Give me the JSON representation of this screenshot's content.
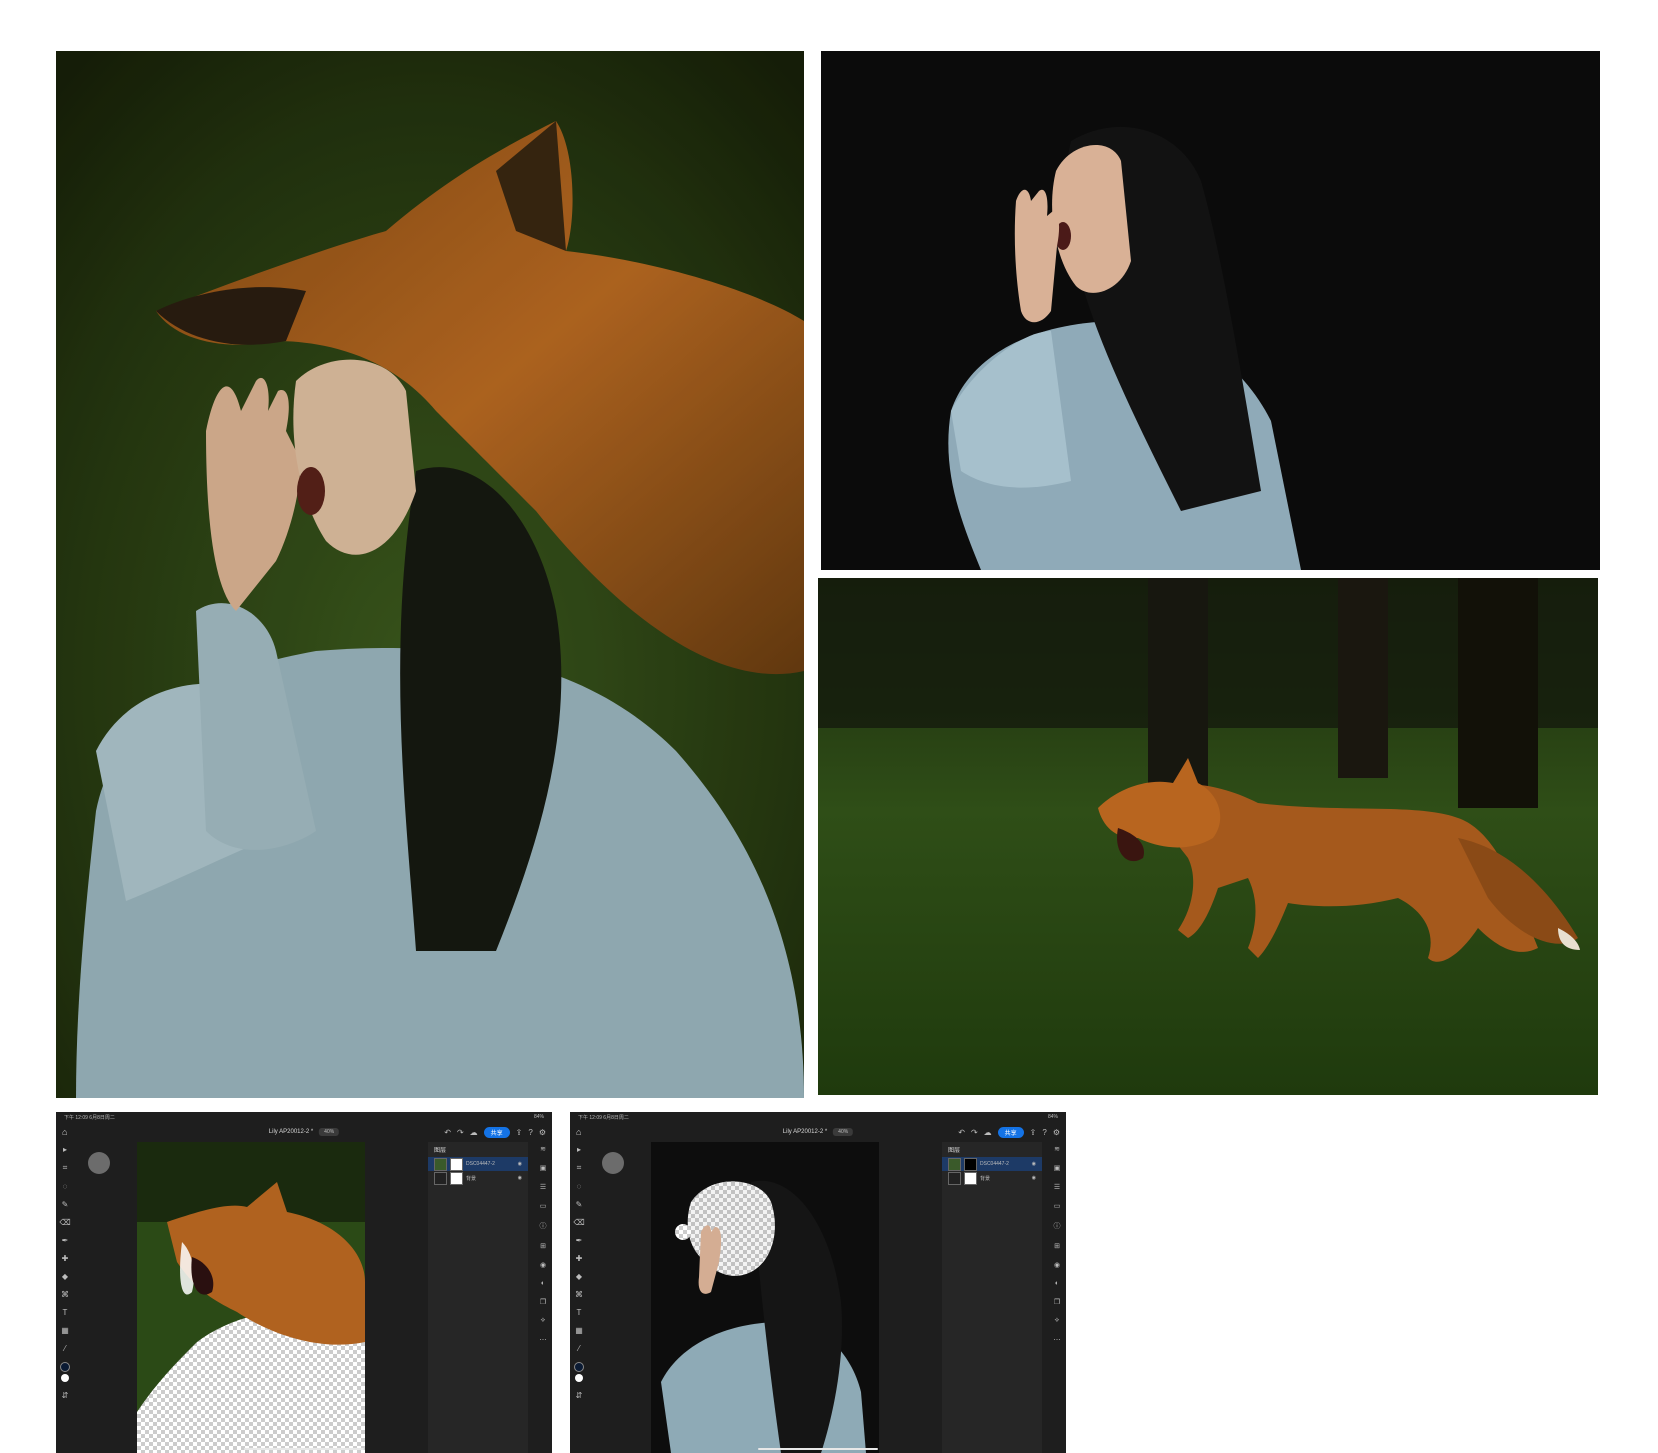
{
  "images": {
    "main_composite": "composite: girl with fox head screaming in forest",
    "woman_photo": "woman yawning with hand near mouth, dark background",
    "fox_photo": "red fox with open mouth walking on grass"
  },
  "app_left": {
    "status_time": "下午 12:09",
    "status_date": "6月8日周二",
    "battery": "84%",
    "doc_title": "Lily AP20012-2 *",
    "zoom": "40%",
    "share_label": "共享",
    "layers_title": "图层",
    "layers": [
      {
        "name": "DSC04447-2",
        "selected": true
      },
      {
        "name": "背景",
        "selected": false
      }
    ]
  },
  "app_right": {
    "status_time": "下午 12:09",
    "status_date": "6月8日周二",
    "battery": "84%",
    "doc_title": "Lily AP20012-2 *",
    "zoom": "40%",
    "share_label": "共享",
    "layers_title": "图层",
    "layers": [
      {
        "name": "DSC04447-2",
        "selected": true
      },
      {
        "name": "背景",
        "selected": false
      }
    ]
  },
  "colors": {
    "accent": "#1473e6",
    "app_bg": "#1e1e1e",
    "forest_green": "#2f4a18",
    "fox_orange": "#b5641f",
    "sweater_blue": "#a9c3d1"
  }
}
